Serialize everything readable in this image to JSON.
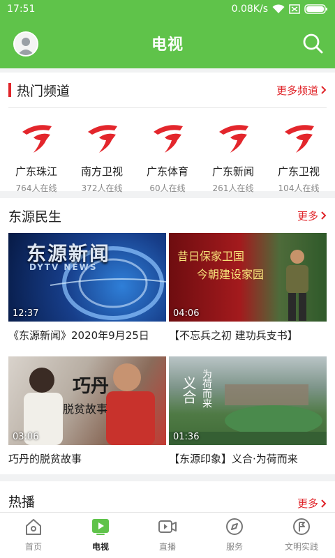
{
  "status": {
    "time": "17:51",
    "network": "0.08K/s"
  },
  "header": {
    "title": "电视"
  },
  "hot_channels": {
    "title": "热门频道",
    "more_label": "更多频道",
    "items": [
      {
        "name": "广东珠江",
        "viewers": "764人在线"
      },
      {
        "name": "南方卫视",
        "viewers": "372人在线"
      },
      {
        "name": "广东体育",
        "viewers": "60人在线"
      },
      {
        "name": "广东新闻",
        "viewers": "261人在线"
      },
      {
        "name": "广东卫视",
        "viewers": "104人在线"
      }
    ]
  },
  "dongyuan": {
    "title": "东源民生",
    "more_label": "更多",
    "videos": [
      {
        "title": "《东源新闻》2020年9月25日",
        "duration": "12:37",
        "thumb_text": "东源新闻",
        "thumb_sub": "DYTV NEWS"
      },
      {
        "title": "【不忘兵之初 建功兵支书】",
        "duration": "04:06",
        "thumb_text": "昔日保家卫国",
        "thumb_sub": "今朝建设家园"
      },
      {
        "title": "巧丹的脱贫故事",
        "duration": "03:06",
        "thumb_text": "巧丹",
        "thumb_sub": "脱贫故事"
      },
      {
        "title": "【东源印象】义合·为荷而来",
        "duration": "01:36",
        "thumb_text": "义合",
        "thumb_sub": "为荷而来"
      }
    ]
  },
  "hot_play": {
    "title": "热播",
    "more_label": "更多"
  },
  "tabs": [
    {
      "label": "首页",
      "icon": "home-icon"
    },
    {
      "label": "电视",
      "icon": "tv-icon"
    },
    {
      "label": "直播",
      "icon": "live-camera-icon"
    },
    {
      "label": "服务",
      "icon": "compass-icon"
    },
    {
      "label": "文明实践",
      "icon": "flag-icon"
    }
  ],
  "colors": {
    "brand_green": "#5fc34a",
    "accent_red": "#e0252a"
  }
}
